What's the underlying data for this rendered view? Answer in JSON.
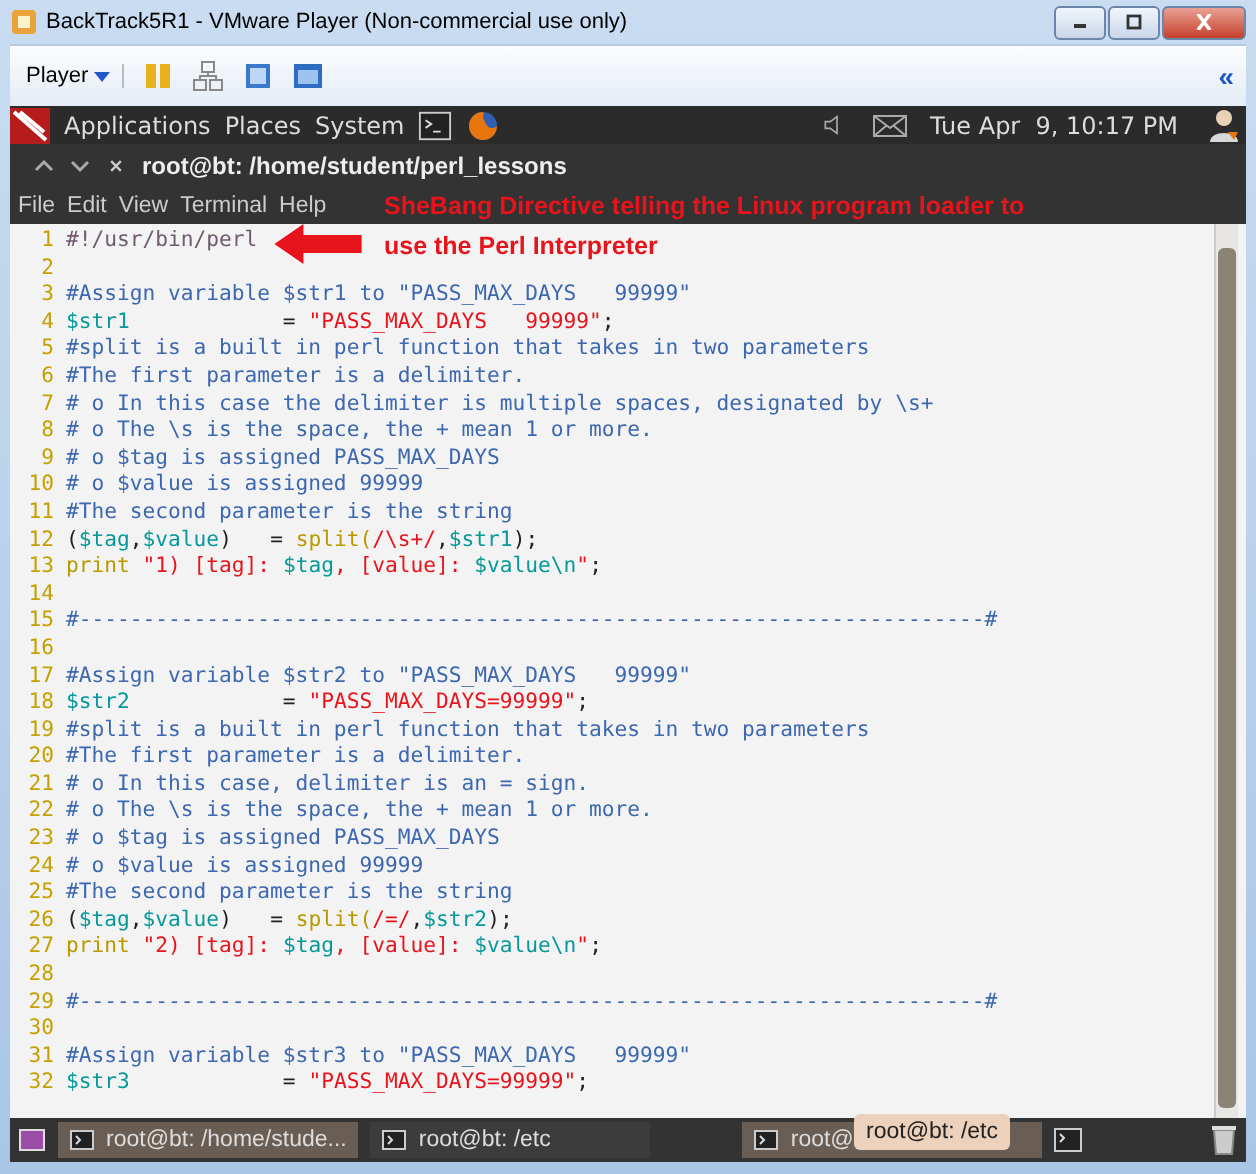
{
  "window": {
    "title": "BackTrack5R1 - VMware Player (Non-commercial use only)"
  },
  "vm_toolbar": {
    "menu": "Player",
    "collapse": "«"
  },
  "panel": {
    "menus": [
      "Applications",
      "Places",
      "System"
    ],
    "clock": "Tue Apr  9, 10:17 PM"
  },
  "terminal": {
    "title": "root@bt: /home/student/perl_lessons",
    "menu": [
      "File",
      "Edit",
      "View",
      "Terminal",
      "Help"
    ]
  },
  "annotation": {
    "line_1": "SheBang Directive telling the Linux program loader to",
    "line_2": "use the Perl Interpreter"
  },
  "code_lines": [
    {
      "number": "1",
      "segments": [
        {
          "kind": "shebang",
          "text": "#!/usr/bin/perl"
        }
      ]
    },
    {
      "number": "2"
    },
    {
      "number": "3",
      "segments": [
        {
          "kind": "comment",
          "text": "#Assign variable $str1 to \"PASS_MAX_DAYS   99999\""
        }
      ]
    },
    {
      "number": "4",
      "segments": [
        {
          "kind": "var",
          "text": "$str1"
        },
        {
          "kind": "plain",
          "text": "            = "
        },
        {
          "kind": "string",
          "text": "\"PASS_MAX_DAYS   99999\""
        },
        {
          "kind": "plain",
          "text": ";"
        }
      ]
    },
    {
      "number": "5",
      "segments": [
        {
          "kind": "comment",
          "text": "#split is a built in perl function that takes in two parameters"
        }
      ]
    },
    {
      "number": "6",
      "segments": [
        {
          "kind": "comment",
          "text": "#The first parameter is a delimiter."
        }
      ]
    },
    {
      "number": "7",
      "segments": [
        {
          "kind": "comment",
          "text": "# o In this case the delimiter is multiple spaces, designated by \\s+"
        }
      ]
    },
    {
      "number": "8",
      "segments": [
        {
          "kind": "comment",
          "text": "# o The \\s is the space, the + mean 1 or more."
        }
      ]
    },
    {
      "number": "9",
      "segments": [
        {
          "kind": "comment",
          "text": "# o $tag is assigned PASS_MAX_DAYS"
        }
      ]
    },
    {
      "number": "10",
      "segments": [
        {
          "kind": "comment",
          "text": "# o $value is assigned 99999"
        }
      ]
    },
    {
      "number": "11",
      "segments": [
        {
          "kind": "comment",
          "text": "#The second parameter is the string"
        }
      ]
    },
    {
      "number": "12",
      "segments": [
        {
          "kind": "plain",
          "text": "("
        },
        {
          "kind": "var",
          "text": "$tag"
        },
        {
          "kind": "plain",
          "text": ","
        },
        {
          "kind": "var",
          "text": "$value"
        },
        {
          "kind": "plain",
          "text": ")   = "
        },
        {
          "kind": "func",
          "text": "split("
        },
        {
          "kind": "string",
          "text": "/\\s+/"
        },
        {
          "kind": "plain",
          "text": ","
        },
        {
          "kind": "var",
          "text": "$str1"
        },
        {
          "kind": "plain",
          "text": ");"
        }
      ]
    },
    {
      "number": "13",
      "segments": [
        {
          "kind": "func",
          "text": "print "
        },
        {
          "kind": "string",
          "text": "\"1) [tag]: "
        },
        {
          "kind": "var",
          "text": "$tag"
        },
        {
          "kind": "string",
          "text": ", [value]: "
        },
        {
          "kind": "var",
          "text": "$value\\n"
        },
        {
          "kind": "string",
          "text": "\""
        },
        {
          "kind": "plain",
          "text": ";"
        }
      ]
    },
    {
      "number": "14"
    },
    {
      "number": "15",
      "segments": [
        {
          "kind": "comment",
          "text": "#-----------------------------------------------------------------------#"
        }
      ]
    },
    {
      "number": "16"
    },
    {
      "number": "17",
      "segments": [
        {
          "kind": "comment",
          "text": "#Assign variable $str2 to \"PASS_MAX_DAYS   99999\""
        }
      ]
    },
    {
      "number": "18",
      "segments": [
        {
          "kind": "var",
          "text": "$str2"
        },
        {
          "kind": "plain",
          "text": "            = "
        },
        {
          "kind": "string",
          "text": "\"PASS_MAX_DAYS=99999\""
        },
        {
          "kind": "plain",
          "text": ";"
        }
      ]
    },
    {
      "number": "19",
      "segments": [
        {
          "kind": "comment",
          "text": "#split is a built in perl function that takes in two parameters"
        }
      ]
    },
    {
      "number": "20",
      "segments": [
        {
          "kind": "comment",
          "text": "#The first parameter is a delimiter."
        }
      ]
    },
    {
      "number": "21",
      "segments": [
        {
          "kind": "comment",
          "text": "# o In this case, delimiter is an = sign."
        }
      ]
    },
    {
      "number": "22",
      "segments": [
        {
          "kind": "comment",
          "text": "# o The \\s is the space, the + mean 1 or more."
        }
      ]
    },
    {
      "number": "23",
      "segments": [
        {
          "kind": "comment",
          "text": "# o $tag is assigned PASS_MAX_DAYS"
        }
      ]
    },
    {
      "number": "24",
      "segments": [
        {
          "kind": "comment",
          "text": "# o $value is assigned 99999"
        }
      ]
    },
    {
      "number": "25",
      "segments": [
        {
          "kind": "comment",
          "text": "#The second parameter is the string"
        }
      ]
    },
    {
      "number": "26",
      "segments": [
        {
          "kind": "plain",
          "text": "("
        },
        {
          "kind": "var",
          "text": "$tag"
        },
        {
          "kind": "plain",
          "text": ","
        },
        {
          "kind": "var",
          "text": "$value"
        },
        {
          "kind": "plain",
          "text": ")   = "
        },
        {
          "kind": "func",
          "text": "split("
        },
        {
          "kind": "string",
          "text": "/=/"
        },
        {
          "kind": "plain",
          "text": ","
        },
        {
          "kind": "var",
          "text": "$str2"
        },
        {
          "kind": "plain",
          "text": ");"
        }
      ]
    },
    {
      "number": "27",
      "segments": [
        {
          "kind": "func",
          "text": "print "
        },
        {
          "kind": "string",
          "text": "\"2) [tag]: "
        },
        {
          "kind": "var",
          "text": "$tag"
        },
        {
          "kind": "string",
          "text": ", [value]: "
        },
        {
          "kind": "var",
          "text": "$value\\n"
        },
        {
          "kind": "string",
          "text": "\""
        },
        {
          "kind": "plain",
          "text": ";"
        }
      ]
    },
    {
      "number": "28"
    },
    {
      "number": "29",
      "segments": [
        {
          "kind": "comment",
          "text": "#-----------------------------------------------------------------------#"
        }
      ]
    },
    {
      "number": "30"
    },
    {
      "number": "31",
      "segments": [
        {
          "kind": "comment",
          "text": "#Assign variable $str3 to \"PASS_MAX_DAYS   99999\""
        }
      ]
    },
    {
      "number": "32",
      "segments": [
        {
          "kind": "var",
          "text": "$str3"
        },
        {
          "kind": "plain",
          "text": "            = "
        },
        {
          "kind": "string",
          "text": "\"PASS_MAX_DAYS=99999\""
        },
        {
          "kind": "plain",
          "text": ";"
        }
      ]
    }
  ],
  "taskbar": {
    "items": [
      {
        "label": "root@bt: /home/stude...",
        "selected": true
      },
      {
        "label": "root@bt: /etc",
        "selected": false
      },
      {
        "label": "root@",
        "selected": true
      }
    ],
    "tooltip": "root@bt: /etc"
  }
}
